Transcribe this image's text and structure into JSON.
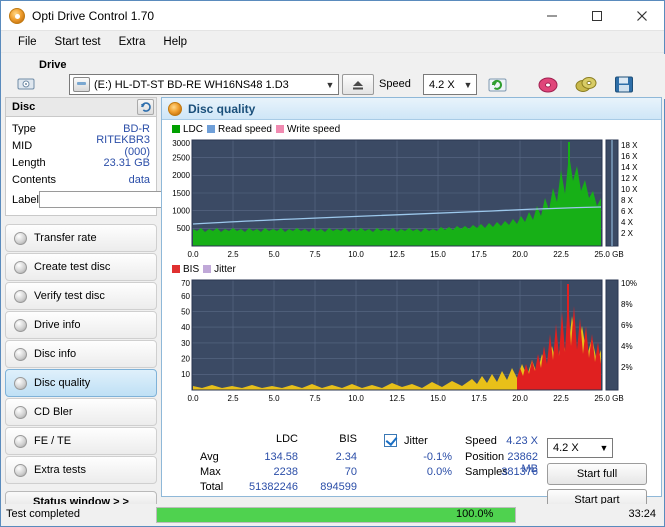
{
  "window": {
    "title": "Opti Drive Control 1.70"
  },
  "menu": {
    "items": [
      "File",
      "Start test",
      "Extra",
      "Help"
    ]
  },
  "toolbar": {
    "drive_label": "Drive",
    "drive_value": "(E:)  HL-DT-ST BD-RE  WH16NS48 1.D3",
    "speed_label": "Speed",
    "speed_value": "4.2 X"
  },
  "disc": {
    "header": "Disc",
    "rows": [
      {
        "key": "Type",
        "value": "BD-R"
      },
      {
        "key": "MID",
        "value": "RITEKBR3 (000)"
      },
      {
        "key": "Length",
        "value": "23.31 GB"
      },
      {
        "key": "Contents",
        "value": "data"
      }
    ],
    "label_key": "Label",
    "label_value": ""
  },
  "nav": {
    "items": [
      "Transfer rate",
      "Create test disc",
      "Verify test disc",
      "Drive info",
      "Disc info",
      "Disc quality",
      "CD Bler",
      "FE / TE",
      "Extra tests"
    ],
    "active": "Disc quality",
    "status_button": "Status window > >"
  },
  "panel": {
    "title": "Disc quality",
    "legend_top": [
      {
        "name": "LDC",
        "color": "#00a000"
      },
      {
        "name": "Read speed",
        "color": "#6f9fd8"
      },
      {
        "name": "Write speed",
        "color": "#f08ab0"
      }
    ],
    "legend_bottom": [
      {
        "name": "BIS",
        "color": "#e03030"
      },
      {
        "name": "Jitter",
        "color": "#c0a8d8"
      }
    ]
  },
  "chart_data": [
    {
      "type": "area",
      "title": "LDC / Read speed",
      "xlabel": "GB",
      "ylabel": "LDC",
      "xlim": [
        0,
        25.0
      ],
      "ylim": [
        0,
        3000
      ],
      "xticks": [
        "0.0",
        "2.5",
        "5.0",
        "7.5",
        "10.0",
        "12.5",
        "15.0",
        "17.5",
        "20.0",
        "22.5",
        "25.0 GB"
      ],
      "yticks": [
        "500",
        "1000",
        "1500",
        "2000",
        "2500",
        "3000"
      ],
      "y2ticks": [
        "2 X",
        "4 X",
        "6 X",
        "8 X",
        "10 X",
        "12 X",
        "14 X",
        "16 X",
        "18 X"
      ],
      "y2lim": [
        0,
        18
      ],
      "grid": true,
      "series": [
        {
          "name": "LDC",
          "color": "#00a000",
          "note": "dense green spikes, baseline ~250-600 rising sharply after 20 GB, peak ~2238 near 22.6 GB"
        },
        {
          "name": "Read speed",
          "color": "#6f9fd8",
          "note": "smooth curve rising from ~4X to ~6X across disc"
        }
      ]
    },
    {
      "type": "area",
      "title": "BIS / Jitter",
      "xlabel": "GB",
      "ylabel": "BIS",
      "xlim": [
        0,
        25.0
      ],
      "ylim": [
        0,
        70
      ],
      "xticks": [
        "0.0",
        "2.5",
        "5.0",
        "7.5",
        "10.0",
        "12.5",
        "15.0",
        "17.5",
        "20.0",
        "22.5",
        "25.0 GB"
      ],
      "yticks": [
        "10",
        "20",
        "30",
        "40",
        "50",
        "60",
        "70"
      ],
      "y2ticks": [
        "2%",
        "4%",
        "6%",
        "8%",
        "10%"
      ],
      "y2lim": [
        0,
        10
      ],
      "grid": true,
      "series": [
        {
          "name": "BIS",
          "color": "#e0b000",
          "note": "yellow/orange spikes low until 17 GB then rising, red peaks to 70 near 22.5 GB"
        }
      ]
    }
  ],
  "stats": {
    "col_headers": [
      "LDC",
      "BIS"
    ],
    "rows": [
      {
        "label": "Avg",
        "ldc": "134.58",
        "bis": "2.34"
      },
      {
        "label": "Max",
        "ldc": "2238",
        "bis": "70"
      },
      {
        "label": "Total",
        "ldc": "51382246",
        "bis": "894599"
      }
    ],
    "jitter_label": "Jitter",
    "jitter_avg": "-0.1%",
    "jitter_max": "0.0%",
    "speed_label": "Speed",
    "speed_value": "4.23 X",
    "speed_select": "4.2 X",
    "position_label": "Position",
    "position_value": "23862 MB",
    "samples_label": "Samples",
    "samples_value": "381376",
    "start_full": "Start full",
    "start_part": "Start part"
  },
  "statusbar": {
    "message": "Test completed",
    "progress": 100.0,
    "progress_text": "100.0%",
    "time": "33:24"
  }
}
